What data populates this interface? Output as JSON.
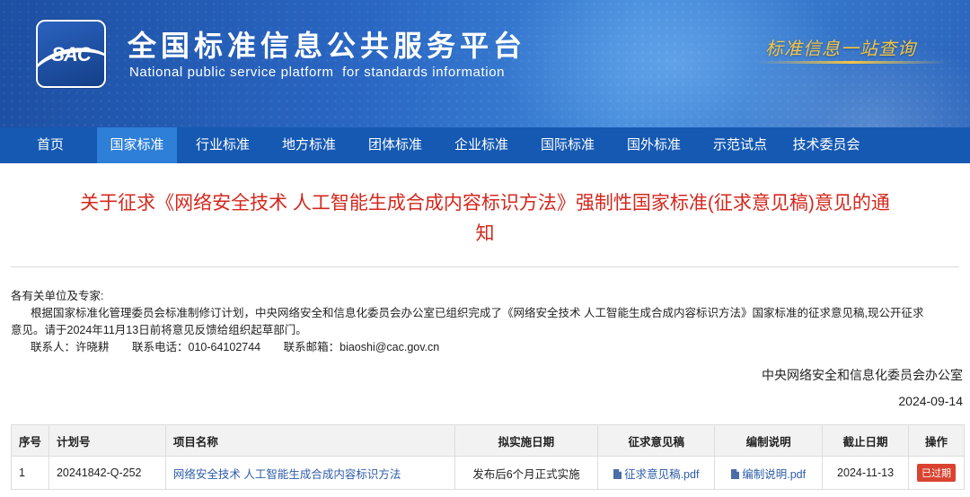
{
  "header": {
    "logo_text": "SAC",
    "site_title_cn": "全国标准信息公共服务平台",
    "site_title_en": "National public service platform  for standards information",
    "slogan": "标准信息一站查询"
  },
  "nav": {
    "items": [
      {
        "label": "首页"
      },
      {
        "label": "国家标准"
      },
      {
        "label": "行业标准"
      },
      {
        "label": "地方标准"
      },
      {
        "label": "团体标准"
      },
      {
        "label": "企业标准"
      },
      {
        "label": "国际标准"
      },
      {
        "label": "国外标准"
      },
      {
        "label": "示范试点"
      },
      {
        "label": "技术委员会"
      }
    ],
    "active": "国家标准"
  },
  "article": {
    "title_line1": "关于征求《网络安全技术 人工智能生成合成内容标识方法》强制性国家标准(征求意见稿)意见的通",
    "title_line2": "知",
    "salutation": "各有关单位及专家:",
    "para_line1": "根据国家标准化管理委员会标准制修订计划，中央网络安全和信息化委员会办公室已组织完成了《网络安全技术 人工智能生成合成内容标识方法》国家标准的征求意见稿,现公开征求",
    "para_line2": "意见。请于2024年11月13日前将意见反馈给组织起草部门。",
    "contact_person": "联系人：许晓耕",
    "contact_phone": "联系电话：010-64102744",
    "contact_email": "联系邮箱：biaoshi@cac.gov.cn",
    "issuer": "中央网络安全和信息化委员会办公室",
    "date": "2024-09-14"
  },
  "table": {
    "headers": [
      "序号",
      "计划号",
      "项目名称",
      "拟实施日期",
      "征求意见稿",
      "编制说明",
      "截止日期",
      "操作"
    ],
    "rows": [
      {
        "no": "1",
        "plan_no": "20241842-Q-252",
        "project_name": "网络安全技术 人工智能生成合成内容标识方法",
        "impl_date": "发布后6个月正式实施",
        "draft_file": "征求意见稿.pdf",
        "explain_file": "编制说明.pdf",
        "deadline": "2024-11-13",
        "status": "已过期"
      }
    ]
  },
  "colors": {
    "nav_bg": "#1559b3",
    "nav_active": "#2d7fd8",
    "title_red": "#d3281d",
    "link_blue": "#2d5ca8",
    "badge_red": "#d9432f",
    "slogan_gold": "#f5c542"
  }
}
